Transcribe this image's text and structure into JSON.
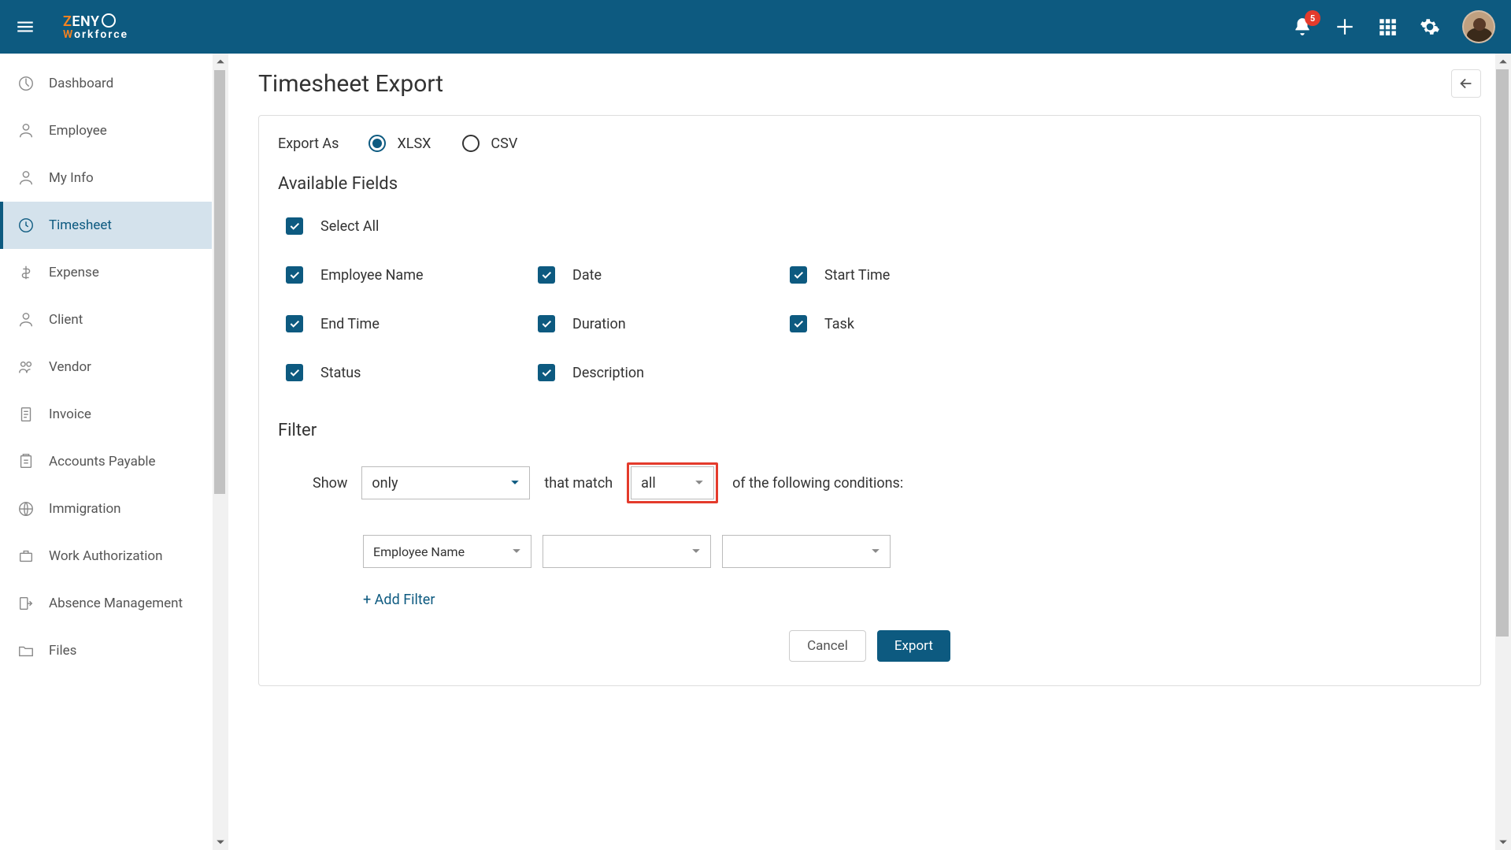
{
  "header": {
    "logo_top_pre": "Z",
    "logo_top_rest": "ENY",
    "logo_bottom_pre": "W",
    "logo_bottom_rest": "orkforce",
    "notification_count": "5"
  },
  "sidebar": {
    "items": [
      {
        "label": "Dashboard",
        "icon": "dashboard",
        "active": false
      },
      {
        "label": "Employee",
        "icon": "person",
        "active": false
      },
      {
        "label": "My Info",
        "icon": "person",
        "active": false
      },
      {
        "label": "Timesheet",
        "icon": "clock",
        "active": true
      },
      {
        "label": "Expense",
        "icon": "money",
        "active": false
      },
      {
        "label": "Client",
        "icon": "person",
        "active": false
      },
      {
        "label": "Vendor",
        "icon": "people",
        "active": false
      },
      {
        "label": "Invoice",
        "icon": "doc",
        "active": false
      },
      {
        "label": "Accounts Payable",
        "icon": "paper",
        "active": false
      },
      {
        "label": "Immigration",
        "icon": "globe",
        "active": false
      },
      {
        "label": "Work Authorization",
        "icon": "briefcase",
        "active": false
      },
      {
        "label": "Absence Management",
        "icon": "exit",
        "active": false
      },
      {
        "label": "Files",
        "icon": "folder",
        "active": false
      }
    ]
  },
  "page": {
    "title": "Timesheet Export",
    "export_as_label": "Export As",
    "formats": [
      {
        "label": "XLSX",
        "selected": true
      },
      {
        "label": "CSV",
        "selected": false
      }
    ],
    "available_fields_heading": "Available Fields",
    "select_all_label": "Select All",
    "fields": [
      {
        "label": "Employee Name",
        "checked": true
      },
      {
        "label": "Date",
        "checked": true
      },
      {
        "label": "Start Time",
        "checked": true
      },
      {
        "label": "End Time",
        "checked": true
      },
      {
        "label": "Duration",
        "checked": true
      },
      {
        "label": "Task",
        "checked": true
      },
      {
        "label": "Status",
        "checked": true
      },
      {
        "label": "Description",
        "checked": true
      }
    ],
    "filter_heading": "Filter",
    "filter": {
      "show_label": "Show",
      "scope_value": "only",
      "that_match_label": "that match",
      "match_value": "all",
      "conditions_tail": "of the following conditions:",
      "condition_field": "Employee Name",
      "add_filter_label": "+ Add Filter"
    },
    "buttons": {
      "cancel": "Cancel",
      "export": "Export"
    }
  }
}
